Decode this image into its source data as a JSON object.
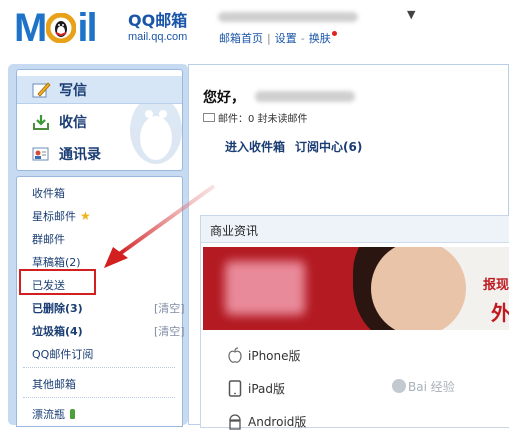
{
  "header": {
    "logo_text": "MOil",
    "brand_title": "QQ邮箱",
    "brand_url": "mail.qq.com",
    "links": [
      "邮箱首页",
      "设置",
      "换肤"
    ],
    "separator": "|",
    "separator2": "-"
  },
  "sidebar": {
    "commands": [
      {
        "label": "写信",
        "icon": "compose-pen-icon"
      },
      {
        "label": "收信",
        "icon": "inbox-download-icon"
      },
      {
        "label": "通讯录",
        "icon": "contacts-card-icon"
      }
    ],
    "folders": {
      "inbox": "收件箱",
      "starred": "星标邮件",
      "groups": "群邮件",
      "drafts": "草稿箱(2)",
      "sent": "已发送",
      "deleted": "已删除(3)",
      "deleted_clear": "[清空]",
      "spam": "垃圾箱(4)",
      "spam_clear": "[清空]",
      "subscriptions": "QQ邮件订阅",
      "other": "其他邮箱",
      "bottle": "漂流瓶"
    }
  },
  "main": {
    "greeting": "您好，",
    "mail_status": "邮件：0 封未读邮件",
    "link_inbox": "进入收件箱",
    "link_subscribe": "订阅中心(6)",
    "biz_title": "商业资讯",
    "banner_text1": "报现",
    "banner_text2": "外",
    "devices": [
      "iPhone版",
      "iPad版",
      "Android版"
    ]
  },
  "watermark": "Bai 经验",
  "colors": {
    "brand_blue": "#1e73c8",
    "highlight_red": "#d21f1f",
    "sidebar_bg": "#c6daf2"
  }
}
